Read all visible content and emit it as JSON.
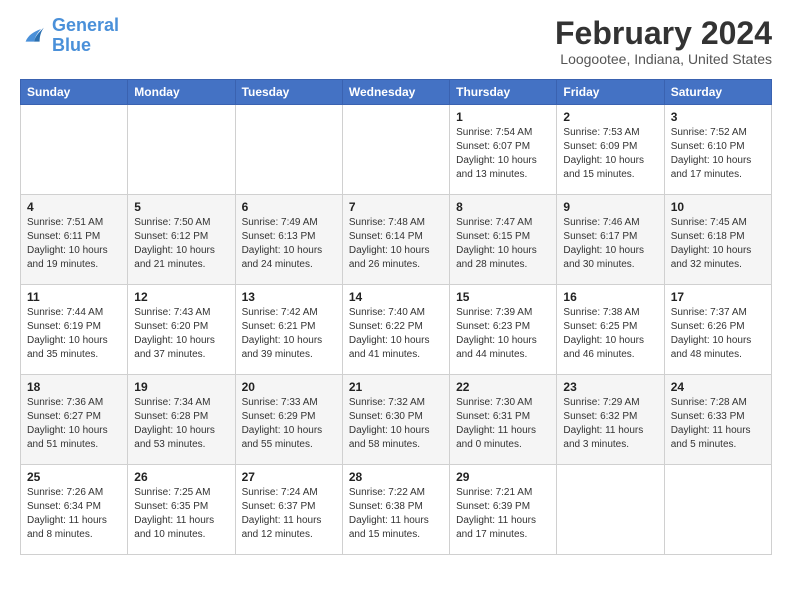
{
  "logo": {
    "text_general": "General",
    "text_blue": "Blue"
  },
  "title": "February 2024",
  "subtitle": "Loogootee, Indiana, United States",
  "days_of_week": [
    "Sunday",
    "Monday",
    "Tuesday",
    "Wednesday",
    "Thursday",
    "Friday",
    "Saturday"
  ],
  "weeks": [
    [
      {
        "day": "",
        "info": ""
      },
      {
        "day": "",
        "info": ""
      },
      {
        "day": "",
        "info": ""
      },
      {
        "day": "",
        "info": ""
      },
      {
        "day": "1",
        "info": "Sunrise: 7:54 AM\nSunset: 6:07 PM\nDaylight: 10 hours\nand 13 minutes."
      },
      {
        "day": "2",
        "info": "Sunrise: 7:53 AM\nSunset: 6:09 PM\nDaylight: 10 hours\nand 15 minutes."
      },
      {
        "day": "3",
        "info": "Sunrise: 7:52 AM\nSunset: 6:10 PM\nDaylight: 10 hours\nand 17 minutes."
      }
    ],
    [
      {
        "day": "4",
        "info": "Sunrise: 7:51 AM\nSunset: 6:11 PM\nDaylight: 10 hours\nand 19 minutes."
      },
      {
        "day": "5",
        "info": "Sunrise: 7:50 AM\nSunset: 6:12 PM\nDaylight: 10 hours\nand 21 minutes."
      },
      {
        "day": "6",
        "info": "Sunrise: 7:49 AM\nSunset: 6:13 PM\nDaylight: 10 hours\nand 24 minutes."
      },
      {
        "day": "7",
        "info": "Sunrise: 7:48 AM\nSunset: 6:14 PM\nDaylight: 10 hours\nand 26 minutes."
      },
      {
        "day": "8",
        "info": "Sunrise: 7:47 AM\nSunset: 6:15 PM\nDaylight: 10 hours\nand 28 minutes."
      },
      {
        "day": "9",
        "info": "Sunrise: 7:46 AM\nSunset: 6:17 PM\nDaylight: 10 hours\nand 30 minutes."
      },
      {
        "day": "10",
        "info": "Sunrise: 7:45 AM\nSunset: 6:18 PM\nDaylight: 10 hours\nand 32 minutes."
      }
    ],
    [
      {
        "day": "11",
        "info": "Sunrise: 7:44 AM\nSunset: 6:19 PM\nDaylight: 10 hours\nand 35 minutes."
      },
      {
        "day": "12",
        "info": "Sunrise: 7:43 AM\nSunset: 6:20 PM\nDaylight: 10 hours\nand 37 minutes."
      },
      {
        "day": "13",
        "info": "Sunrise: 7:42 AM\nSunset: 6:21 PM\nDaylight: 10 hours\nand 39 minutes."
      },
      {
        "day": "14",
        "info": "Sunrise: 7:40 AM\nSunset: 6:22 PM\nDaylight: 10 hours\nand 41 minutes."
      },
      {
        "day": "15",
        "info": "Sunrise: 7:39 AM\nSunset: 6:23 PM\nDaylight: 10 hours\nand 44 minutes."
      },
      {
        "day": "16",
        "info": "Sunrise: 7:38 AM\nSunset: 6:25 PM\nDaylight: 10 hours\nand 46 minutes."
      },
      {
        "day": "17",
        "info": "Sunrise: 7:37 AM\nSunset: 6:26 PM\nDaylight: 10 hours\nand 48 minutes."
      }
    ],
    [
      {
        "day": "18",
        "info": "Sunrise: 7:36 AM\nSunset: 6:27 PM\nDaylight: 10 hours\nand 51 minutes."
      },
      {
        "day": "19",
        "info": "Sunrise: 7:34 AM\nSunset: 6:28 PM\nDaylight: 10 hours\nand 53 minutes."
      },
      {
        "day": "20",
        "info": "Sunrise: 7:33 AM\nSunset: 6:29 PM\nDaylight: 10 hours\nand 55 minutes."
      },
      {
        "day": "21",
        "info": "Sunrise: 7:32 AM\nSunset: 6:30 PM\nDaylight: 10 hours\nand 58 minutes."
      },
      {
        "day": "22",
        "info": "Sunrise: 7:30 AM\nSunset: 6:31 PM\nDaylight: 11 hours\nand 0 minutes."
      },
      {
        "day": "23",
        "info": "Sunrise: 7:29 AM\nSunset: 6:32 PM\nDaylight: 11 hours\nand 3 minutes."
      },
      {
        "day": "24",
        "info": "Sunrise: 7:28 AM\nSunset: 6:33 PM\nDaylight: 11 hours\nand 5 minutes."
      }
    ],
    [
      {
        "day": "25",
        "info": "Sunrise: 7:26 AM\nSunset: 6:34 PM\nDaylight: 11 hours\nand 8 minutes."
      },
      {
        "day": "26",
        "info": "Sunrise: 7:25 AM\nSunset: 6:35 PM\nDaylight: 11 hours\nand 10 minutes."
      },
      {
        "day": "27",
        "info": "Sunrise: 7:24 AM\nSunset: 6:37 PM\nDaylight: 11 hours\nand 12 minutes."
      },
      {
        "day": "28",
        "info": "Sunrise: 7:22 AM\nSunset: 6:38 PM\nDaylight: 11 hours\nand 15 minutes."
      },
      {
        "day": "29",
        "info": "Sunrise: 7:21 AM\nSunset: 6:39 PM\nDaylight: 11 hours\nand 17 minutes."
      },
      {
        "day": "",
        "info": ""
      },
      {
        "day": "",
        "info": ""
      }
    ]
  ]
}
